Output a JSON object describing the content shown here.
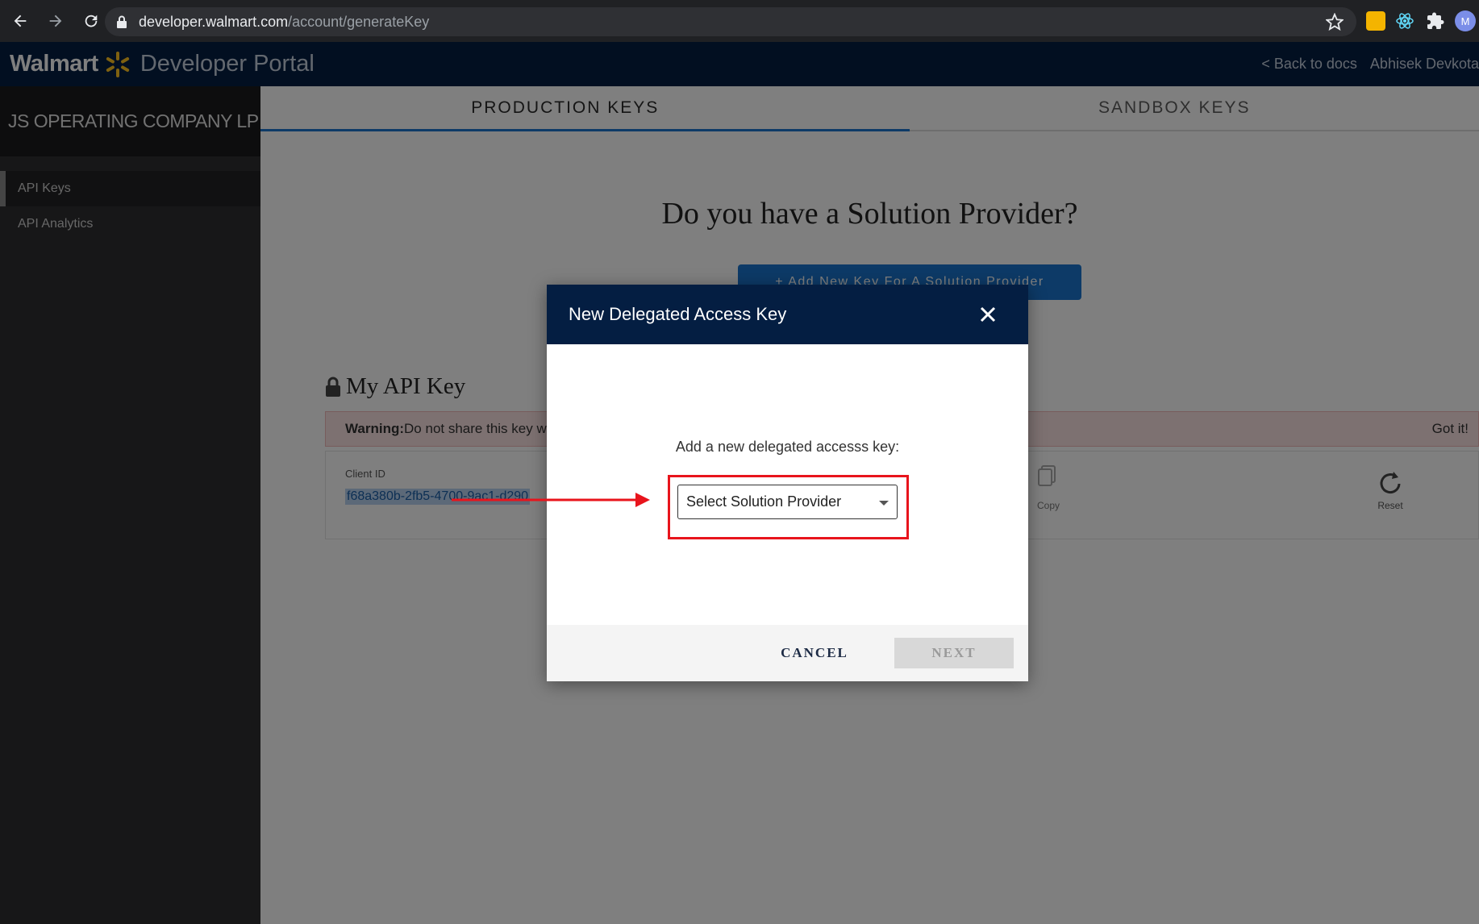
{
  "browser": {
    "url_host": "developer.walmart.com",
    "url_path": "/account/generateKey",
    "profile_initial": "M"
  },
  "header": {
    "brand_name": "Walmart",
    "portal_name": "Developer Portal",
    "back_link": "< Back to docs",
    "user_name": "Abhisek Devkota"
  },
  "sidebar": {
    "company": "JS OPERATING COMPANY LP",
    "items": [
      {
        "label": "API Keys"
      },
      {
        "label": "API Analytics"
      }
    ]
  },
  "tabs": [
    {
      "label": "PRODUCTION KEYS"
    },
    {
      "label": "SANDBOX KEYS"
    }
  ],
  "main": {
    "question": "Do you have a Solution Provider?",
    "add_key_button": "+ Add New Key For A Solution Provider",
    "api_key_title": "My API Key",
    "warning_bold": "Warning:",
    "warning_text": " Do not share this key w",
    "got_it": "Got it!",
    "client_id_label": "Client ID",
    "client_id_value": "f68a380b-2fb5-4700-9ac1-d290",
    "copy_label": "Copy",
    "reset_label": "Reset"
  },
  "modal": {
    "title": "New Delegated Access Key",
    "prompt": "Add a new delegated accesss key:",
    "select_placeholder": "Select Solution Provider",
    "cancel_label": "CANCEL",
    "next_label": "NEXT"
  },
  "colors": {
    "header_bg": "#041e42",
    "accent_blue": "#1a75cf",
    "highlight_red": "#e8141c",
    "spark_yellow": "#ffc220"
  }
}
